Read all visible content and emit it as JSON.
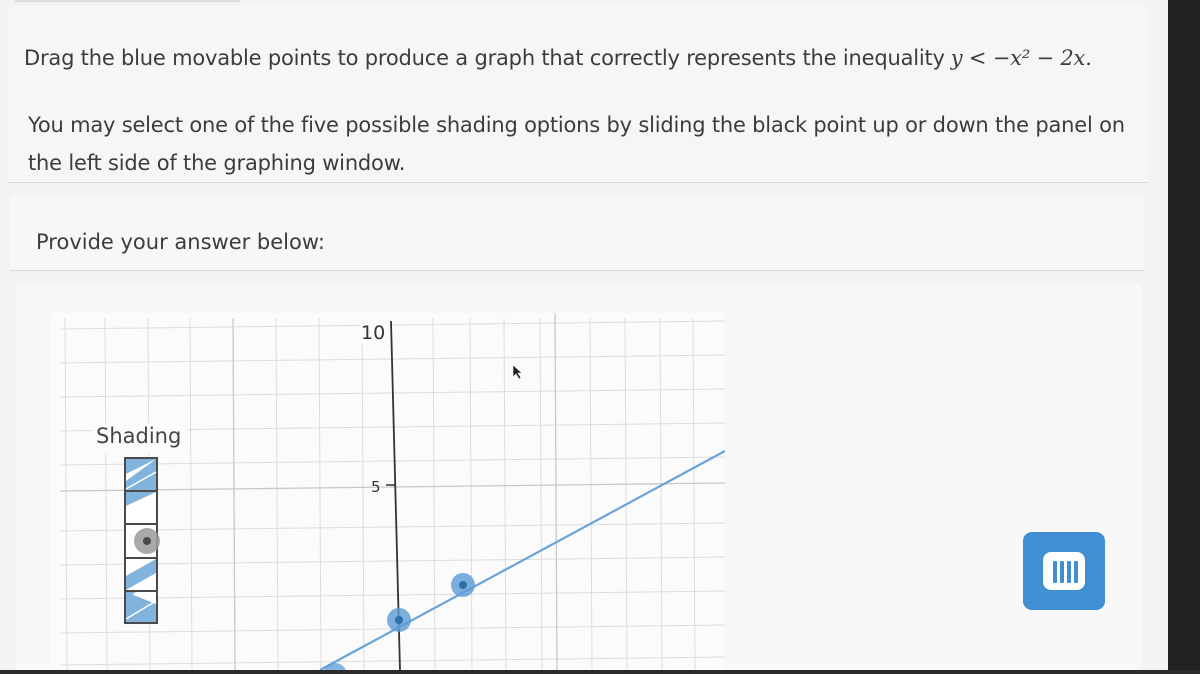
{
  "question": {
    "instruction_text": "Drag the blue movable points to produce a graph that correctly represents the inequality",
    "inequality": "y < −x² − 2x.",
    "shading_help_text": "You may select one of the five possible shading options by sliding the black point up or down the panel on the left side of the graphing window."
  },
  "answer": {
    "prompt_label": "Provide your answer below:"
  },
  "graph": {
    "shading_panel_label": "Shading",
    "shading_options_count": 5,
    "selected_shading_option": 3,
    "y_axis_tick_labels": [
      "10",
      "5"
    ],
    "line_color": "#6aa3d8",
    "point_color": "#5b9bd5",
    "axis_color": "#333333"
  },
  "chat_button": {
    "icon": "chat-icon"
  }
}
